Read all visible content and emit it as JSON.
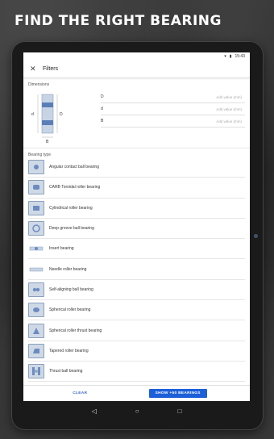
{
  "headline": "FIND THE RIGHT BEARING",
  "status_bar": {
    "time": "15:43"
  },
  "app_bar": {
    "title": "Filters"
  },
  "dimensions": {
    "label": "Dimensions",
    "diagram_labels": {
      "d": "d",
      "D": "D",
      "B": "B"
    },
    "fields": [
      {
        "label": "D",
        "placeholder": "Add value (mm)"
      },
      {
        "label": "d",
        "placeholder": "Add value (mm)"
      },
      {
        "label": "B",
        "placeholder": "Add value (mm)"
      }
    ]
  },
  "bearing_type": {
    "label": "Bearing type",
    "items": [
      {
        "name": "Angular contact ball bearing"
      },
      {
        "name": "CARB Toroidal roller bearing"
      },
      {
        "name": "Cylindrical roller bearing"
      },
      {
        "name": "Deep groove ball bearing"
      },
      {
        "name": "Insert bearing"
      },
      {
        "name": "Needle roller bearing"
      },
      {
        "name": "Self-aligning ball bearing"
      },
      {
        "name": "Spherical roller bearing"
      },
      {
        "name": "Spherical roller thrust bearing"
      },
      {
        "name": "Tapered roller bearing"
      },
      {
        "name": "Thrust ball bearing"
      }
    ]
  },
  "footer": {
    "clear_label": "CLEAR",
    "show_label": "SHOW +50 BEARINGS"
  },
  "colors": {
    "accent": "#1d5fd8",
    "thumb_fill": "#cfd9e6"
  }
}
